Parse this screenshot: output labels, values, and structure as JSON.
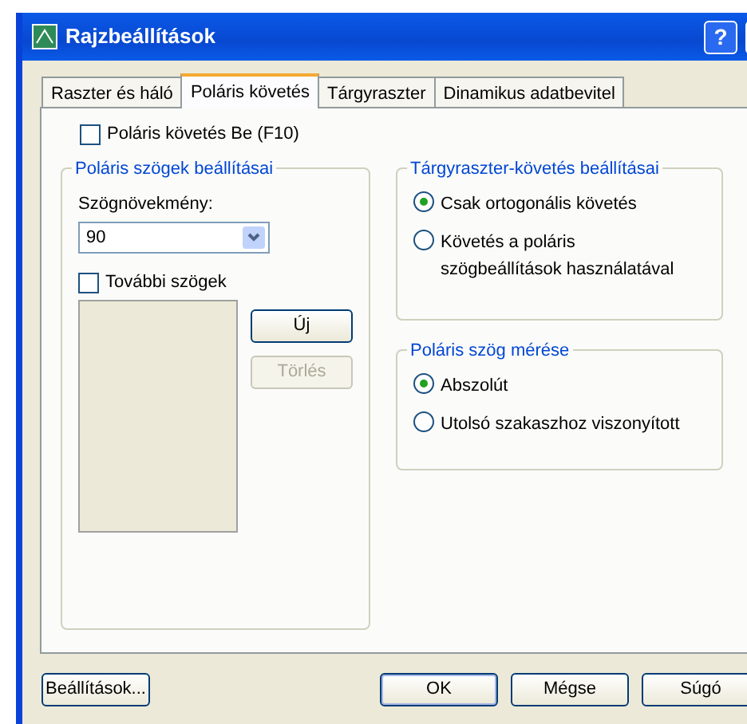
{
  "window": {
    "title": "Rajzbeállítások",
    "help": "?"
  },
  "tabs": [
    {
      "label": "Raszter és háló",
      "selected": false
    },
    {
      "label": "Poláris követés",
      "selected": true
    },
    {
      "label": "Tárgyraszter",
      "selected": false
    },
    {
      "label": "Dinamikus adatbevitel",
      "selected": false
    }
  ],
  "polar_on": {
    "label": "Poláris követés Be (F10)",
    "checked": false
  },
  "polar_angles": {
    "title": "Poláris szögek beállításai",
    "increment_label": "Szögnövekmény:",
    "increment_value": "90",
    "additional": {
      "label": "További szögek",
      "checked": false
    },
    "buttons": [
      {
        "label": "Új",
        "disabled": false
      },
      {
        "label": "Törlés",
        "disabled": true
      }
    ]
  },
  "snap_tracking": {
    "title": "Tárgyraszter-követés beállításai",
    "options": [
      {
        "label": "Csak ortogonális követés",
        "selected": true
      },
      {
        "label": "Követés a poláris szögbeállítások használatával",
        "selected": false
      }
    ]
  },
  "angle_measure": {
    "title": "Poláris szög mérése",
    "options": [
      {
        "label": "Abszolút",
        "selected": true
      },
      {
        "label": "Utolsó szakaszhoz viszonyított",
        "selected": false
      }
    ]
  },
  "footer": {
    "left": "Beállítások...",
    "buttons": [
      {
        "label": "OK",
        "default": true
      },
      {
        "label": "Mégse",
        "default": false
      },
      {
        "label": "Súgó",
        "default": false
      }
    ]
  }
}
